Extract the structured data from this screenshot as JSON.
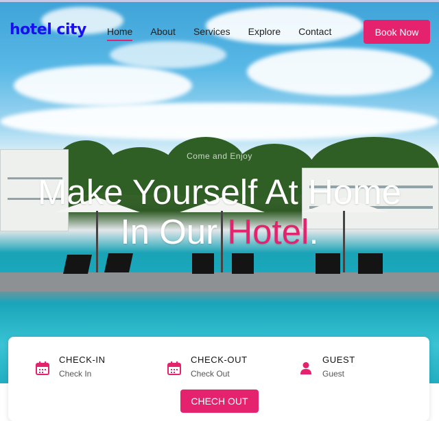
{
  "brand": {
    "logo": "hotel city"
  },
  "nav": {
    "items": [
      {
        "label": "Home",
        "active": true
      },
      {
        "label": "About",
        "active": false
      },
      {
        "label": "Services",
        "active": false
      },
      {
        "label": "Explore",
        "active": false
      },
      {
        "label": "Contact",
        "active": false
      }
    ],
    "book_label": "Book Now"
  },
  "hero": {
    "eyebrow": "Come and Enjoy",
    "line1": "Make Yourself At Home",
    "line2_prefix": "In Our ",
    "line2_accent": "Hotel",
    "line2_suffix": "."
  },
  "booking": {
    "fields": [
      {
        "label": "CHECK-IN",
        "value": "Check In",
        "icon": "calendar-icon"
      },
      {
        "label": "CHECK-OUT",
        "value": "Check Out",
        "icon": "calendar-icon"
      },
      {
        "label": "GUEST",
        "value": "Guest",
        "icon": "user-icon"
      }
    ],
    "button_label": "CHECH OUT"
  },
  "colors": {
    "accent": "#e5226d",
    "logo": "#1a0ff0"
  }
}
